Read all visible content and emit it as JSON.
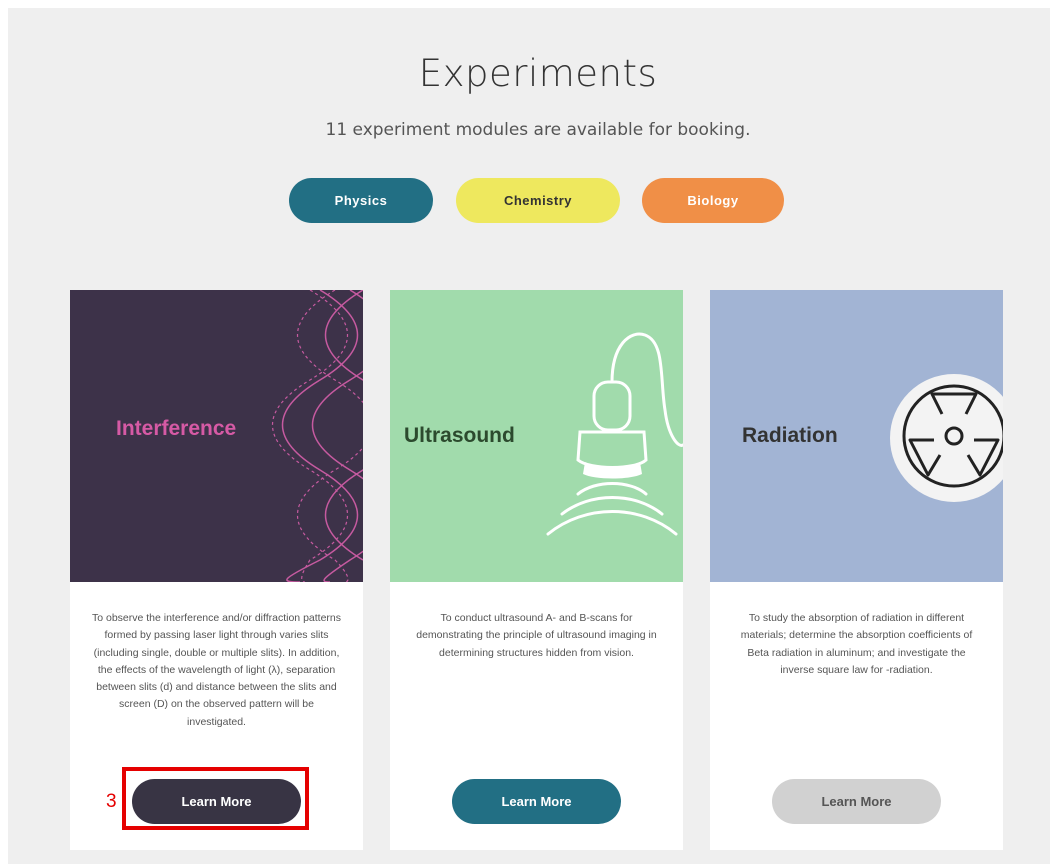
{
  "header": {
    "title": "Experiments",
    "subtitle": "11 experiment modules are available for booking."
  },
  "filters": [
    {
      "label": "Physics",
      "color": "#226f84"
    },
    {
      "label": "Chemistry",
      "color": "#eee85e"
    },
    {
      "label": "Biology",
      "color": "#f08f47"
    }
  ],
  "cards": [
    {
      "image_title": "Interference",
      "description": "To observe the interference and/or diffraction patterns formed by passing laser light through varies slits (including single, double or multiple slits). In addition, the effects of the wavelength of light (λ), separation between slits (d) and distance between the slits and screen (D) on the observed pattern will be investigated.",
      "button_label": "Learn More",
      "image_bg": "#3d3249",
      "accent": "#d65aa5"
    },
    {
      "image_title": "Ultrasound",
      "description": "To conduct ultrasound A- and B-scans for demonstrating the principle of ultrasound imaging in determining structures hidden from vision.",
      "button_label": "Learn More",
      "image_bg": "#a1dbac",
      "accent": "#2c4a2e"
    },
    {
      "image_title": "Radiation",
      "description": "To study the absorption of radiation in different materials; determine the absorption coefficients of Beta radiation in aluminum; and investigate the inverse square law for -radiation.",
      "button_label": "Learn More",
      "image_bg": "#a2b4d4",
      "accent": "#333333"
    }
  ],
  "annotation": {
    "marker_label": "3"
  }
}
